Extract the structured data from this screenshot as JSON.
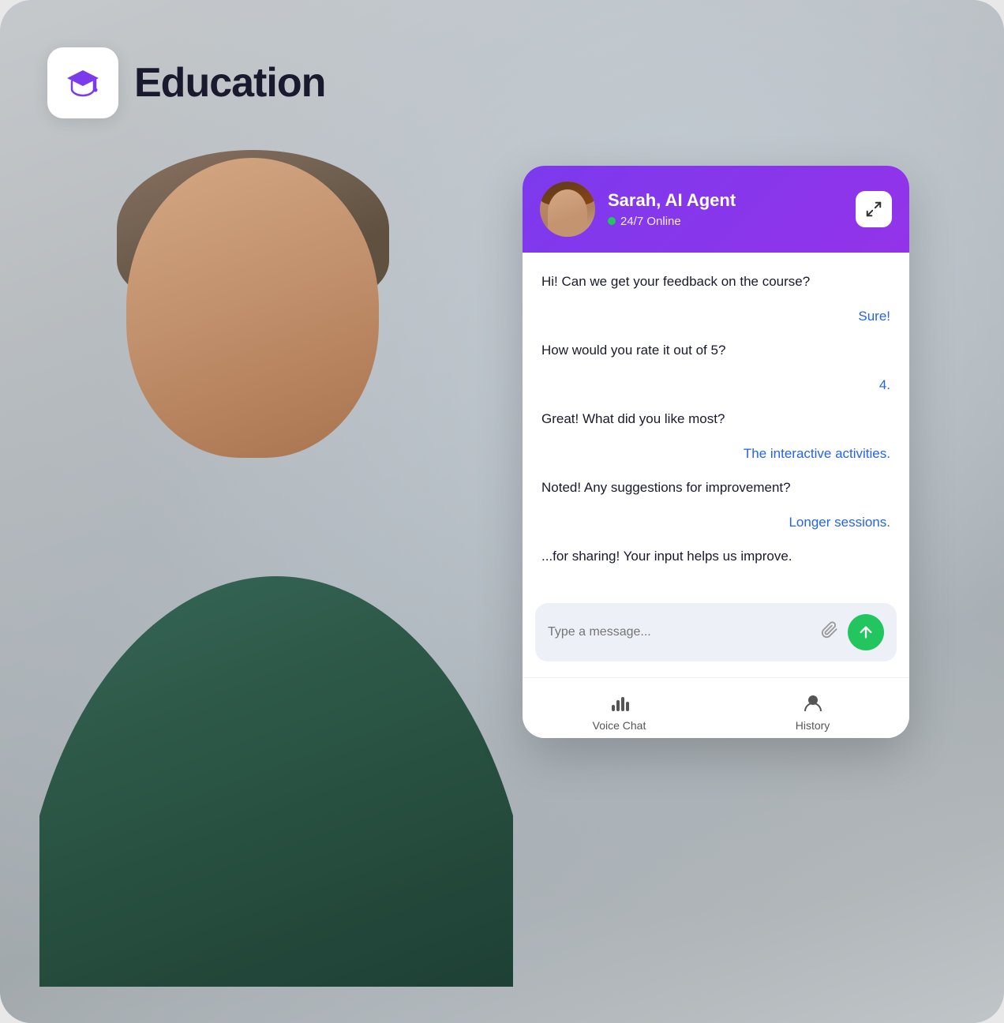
{
  "app": {
    "title": "Education",
    "icon_label": "graduation-cap"
  },
  "chat": {
    "agent_name": "Sarah, AI Agent",
    "agent_status": "24/7 Online",
    "expand_button_label": "expand",
    "messages": [
      {
        "type": "agent",
        "text": "Hi! Can we get your feedback on the course?"
      },
      {
        "type": "user",
        "text": "Sure!"
      },
      {
        "type": "agent",
        "text": "How would you rate it out of 5?"
      },
      {
        "type": "user",
        "text": "4."
      },
      {
        "type": "agent",
        "text": "Great! What did you like most?"
      },
      {
        "type": "user",
        "text": "The interactive activities."
      },
      {
        "type": "agent",
        "text": "Noted! Any suggestions for improvement?"
      },
      {
        "type": "user",
        "text": "Longer sessions."
      },
      {
        "type": "agent",
        "text": "...for sharing! Your input helps us improve."
      }
    ],
    "input_placeholder": "Type a message...",
    "nav_items": [
      {
        "id": "voice-chat",
        "label": "Voice Chat",
        "icon": "mic-bars"
      },
      {
        "id": "history",
        "label": "History",
        "icon": "person-circle"
      }
    ]
  }
}
